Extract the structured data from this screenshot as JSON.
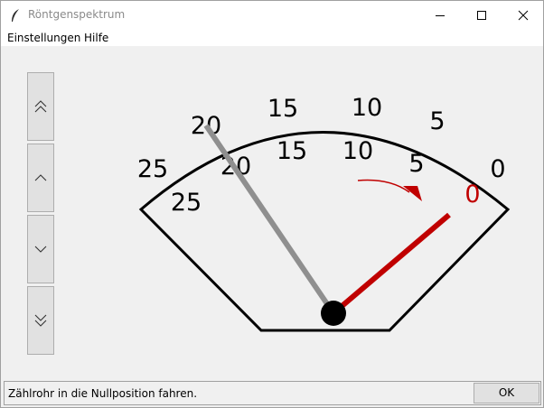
{
  "window": {
    "title": "Röntgenspektrum",
    "app_icon": "feather-icon",
    "controls": {
      "minimize": "minimize-icon",
      "maximize": "maximize-icon",
      "close": "close-icon"
    }
  },
  "menu": {
    "items": [
      "Einstellungen",
      "Hilfe"
    ]
  },
  "sidebar": {
    "buttons": [
      {
        "name": "double-up",
        "icon": "double-chevron-up-icon"
      },
      {
        "name": "up",
        "icon": "chevron-up-icon"
      },
      {
        "name": "down",
        "icon": "chevron-down-icon"
      },
      {
        "name": "double-down",
        "icon": "double-chevron-down-icon"
      }
    ]
  },
  "gauge": {
    "outer_scale": [
      "25",
      "20",
      "15",
      "10",
      "5",
      "0"
    ],
    "inner_scale": [
      "25",
      "20",
      "15",
      "10",
      "5"
    ],
    "target_label": "0",
    "colors": {
      "target": "#c00000",
      "current": "#8f8f8f",
      "outline": "#000000"
    }
  },
  "status": {
    "message": "Zählrohr in die Nullposition fahren.",
    "ok_label": "OK"
  }
}
